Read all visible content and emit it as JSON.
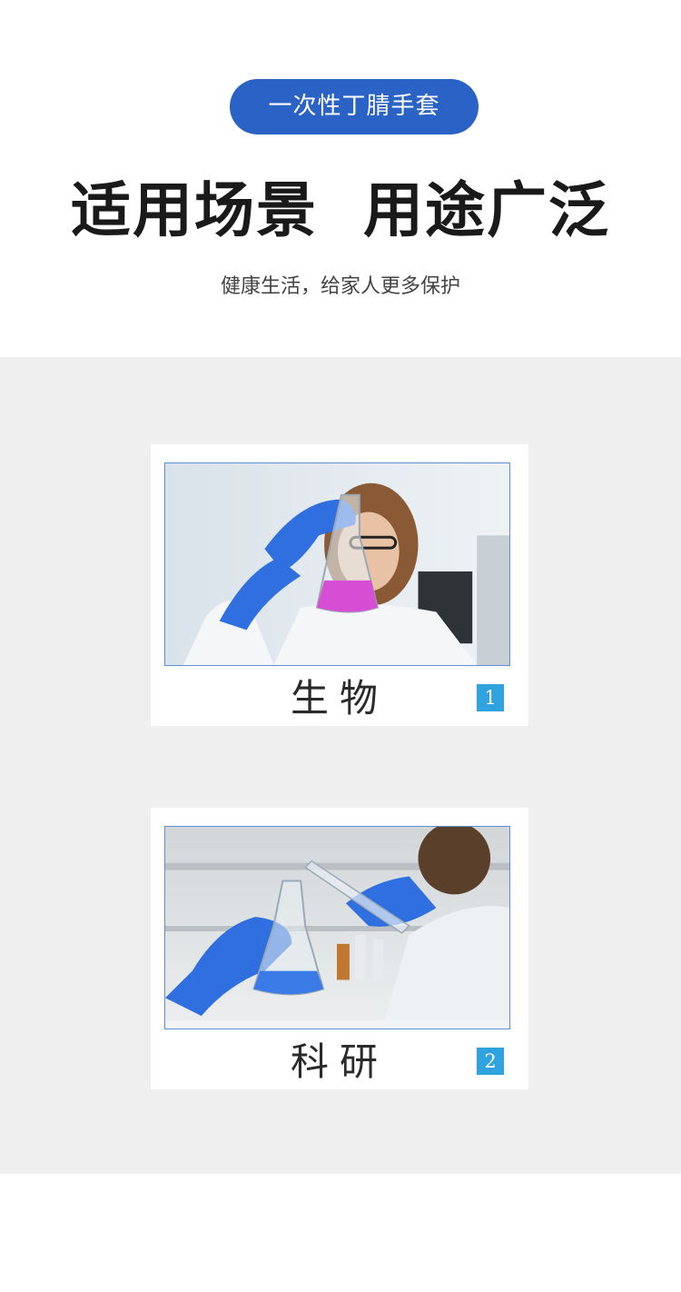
{
  "header": {
    "pill_label": "一次性丁腈手套",
    "headline": "适用场景  用途广泛",
    "subline": "健康生活，给家人更多保护"
  },
  "cards": [
    {
      "caption": "生物",
      "badge": "1",
      "image": "scientist-holding-pink-flask-photo"
    },
    {
      "caption": "科研",
      "badge": "2",
      "image": "lab-pouring-test-tube-into-blue-flask-photo"
    }
  ],
  "colors": {
    "pill": "#2b62c6",
    "band": "#efefef",
    "badge": "#2fa3e0",
    "glove": "#2f6fe0"
  }
}
